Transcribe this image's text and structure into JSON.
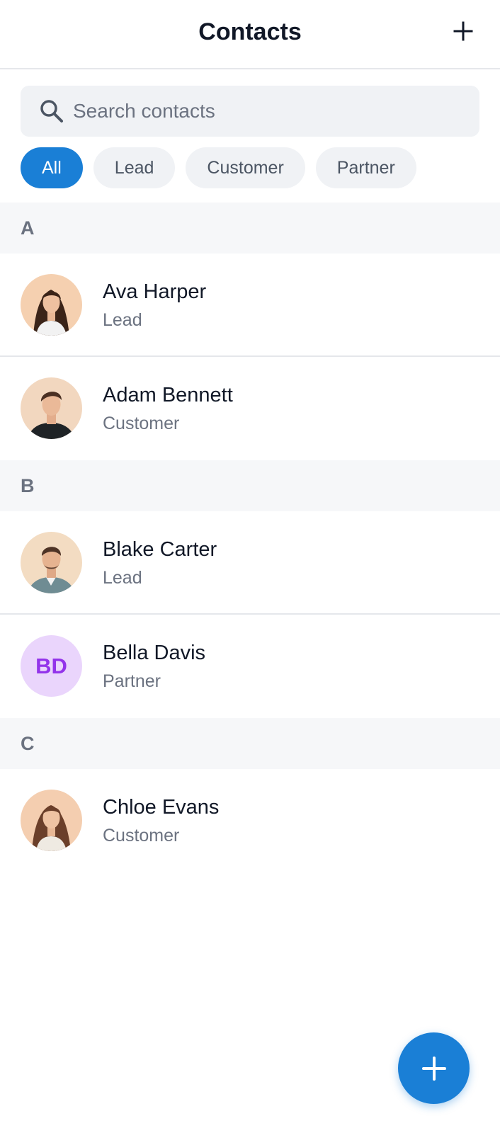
{
  "header": {
    "title": "Contacts",
    "add_icon": "plus-icon"
  },
  "search": {
    "placeholder": "Search contacts",
    "value": "",
    "icon": "search-icon"
  },
  "filters": [
    {
      "label": "All",
      "active": true
    },
    {
      "label": "Lead",
      "active": false
    },
    {
      "label": "Customer",
      "active": false
    },
    {
      "label": "Partner",
      "active": false
    }
  ],
  "sections": [
    {
      "letter": "A",
      "contacts": [
        {
          "name": "Ava Harper",
          "type": "Lead",
          "avatar": "photo"
        },
        {
          "name": "Adam Bennett",
          "type": "Customer",
          "avatar": "photo"
        }
      ]
    },
    {
      "letter": "B",
      "contacts": [
        {
          "name": "Blake Carter",
          "type": "Lead",
          "avatar": "photo"
        },
        {
          "name": "Bella Davis",
          "type": "Partner",
          "avatar": "initials",
          "initials": "BD"
        }
      ]
    },
    {
      "letter": "C",
      "contacts": [
        {
          "name": "Chloe Evans",
          "type": "Customer",
          "avatar": "photo"
        }
      ]
    }
  ],
  "fab": {
    "icon": "plus-icon"
  },
  "colors": {
    "accent": "#1a7fd6",
    "initials_bg": "#ead5fc",
    "initials_text": "#9333ea",
    "section_bg": "#f6f7f9",
    "muted_text": "#6b7280"
  }
}
